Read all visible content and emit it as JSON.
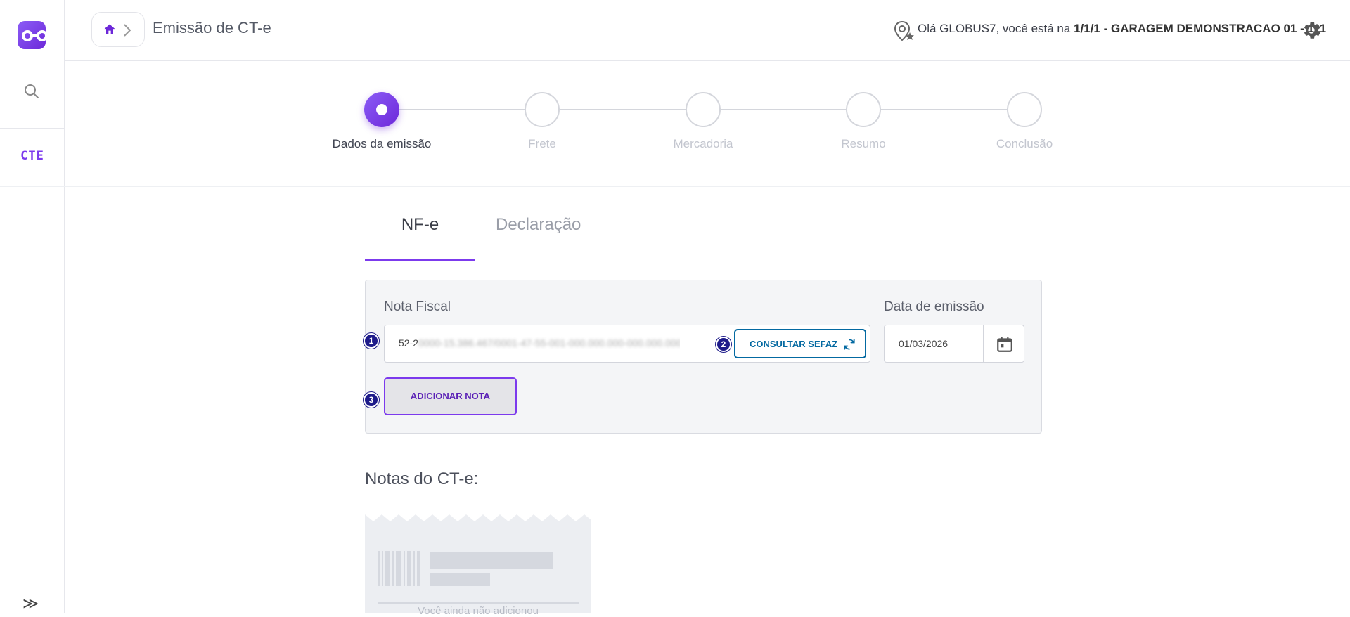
{
  "sidebar": {
    "module_label": "CTE",
    "expand_glyph": "≫"
  },
  "header": {
    "title": "Emissão de CT-e",
    "greeting_prefix": "Olá GLOBUS7, você está na ",
    "greeting_location": "1/1/1 - GARAGEM DEMONSTRACAO 01 - 111"
  },
  "stepper": {
    "steps": [
      {
        "label": "Dados da emissão",
        "active": true
      },
      {
        "label": "Frete",
        "active": false
      },
      {
        "label": "Mercadoria",
        "active": false
      },
      {
        "label": "Resumo",
        "active": false
      },
      {
        "label": "Conclusão",
        "active": false
      }
    ]
  },
  "tabs": [
    {
      "label": "NF-e",
      "selected": true
    },
    {
      "label": "Declaração",
      "selected": false
    }
  ],
  "form": {
    "nota_fiscal_label": "Nota Fiscal",
    "nota_fiscal_value_visible": "52-2",
    "nota_fiscal_value_blurred": "0000-15.386.467/0001-47-55-001-000.000.000-000.000.000-0",
    "consultar_label": "CONSULTAR SEFAZ",
    "data_emissao_label": "Data de emissão",
    "data_emissao_value": "01/03/2026",
    "adicionar_label": "ADICIONAR NOTA"
  },
  "markers": [
    "1",
    "2",
    "3"
  ],
  "notas": {
    "title": "Notas do CT-e:",
    "empty_message": "Você ainda não adicionou"
  },
  "colors": {
    "accent": "#7c3aed",
    "accent_dark": "#6d28d9",
    "sefaz_blue": "#0369a1",
    "marker": "#1e1b8a"
  }
}
